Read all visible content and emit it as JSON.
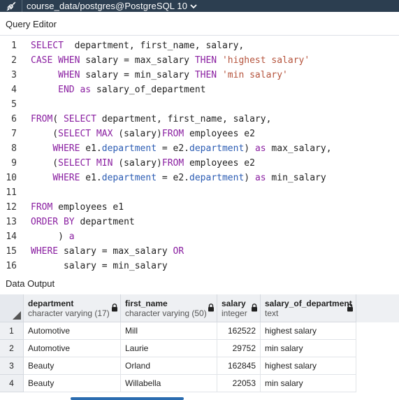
{
  "connection": {
    "label": "course_data/postgres@PostgreSQL 10"
  },
  "query_editor": {
    "title": "Query Editor",
    "lines": [
      {
        "n": "1",
        "segments": [
          [
            "kw",
            "SELECT"
          ],
          [
            "",
            "  department, first_name, salary,"
          ]
        ]
      },
      {
        "n": "2",
        "segments": [
          [
            "kw",
            "CASE WHEN"
          ],
          [
            "",
            " salary = max_salary "
          ],
          [
            "kw",
            "THEN"
          ],
          [
            "",
            " "
          ],
          [
            "st",
            "'highest salary'"
          ]
        ]
      },
      {
        "n": "3",
        "segments": [
          [
            "",
            "     "
          ],
          [
            "kw",
            "WHEN"
          ],
          [
            "",
            " salary = min_salary "
          ],
          [
            "kw",
            "THEN"
          ],
          [
            "",
            " "
          ],
          [
            "st",
            "'min salary'"
          ]
        ]
      },
      {
        "n": "4",
        "segments": [
          [
            "",
            "     "
          ],
          [
            "kw",
            "END"
          ],
          [
            "",
            " "
          ],
          [
            "kw",
            "as"
          ],
          [
            "",
            " salary_of_department"
          ]
        ]
      },
      {
        "n": "5",
        "segments": []
      },
      {
        "n": "6",
        "segments": [
          [
            "kw",
            "FROM"
          ],
          [
            "",
            "( "
          ],
          [
            "kw",
            "SELECT"
          ],
          [
            "",
            " department, first_name, salary,"
          ]
        ]
      },
      {
        "n": "7",
        "segments": [
          [
            "",
            "    ("
          ],
          [
            "kw",
            "SELECT MAX"
          ],
          [
            "",
            " (salary)"
          ],
          [
            "kw",
            "FROM"
          ],
          [
            "",
            " employees e2"
          ]
        ]
      },
      {
        "n": "8",
        "segments": [
          [
            "",
            "    "
          ],
          [
            "kw",
            "WHERE"
          ],
          [
            "",
            " e1."
          ],
          [
            "fld",
            "department"
          ],
          [
            "",
            " = e2."
          ],
          [
            "fld",
            "department"
          ],
          [
            "",
            ") "
          ],
          [
            "kw",
            "as"
          ],
          [
            "",
            " max_salary,"
          ]
        ]
      },
      {
        "n": "9",
        "segments": [
          [
            "",
            "    ("
          ],
          [
            "kw",
            "SELECT MIN"
          ],
          [
            "",
            " (salary)"
          ],
          [
            "kw",
            "FROM"
          ],
          [
            "",
            " employees e2"
          ]
        ]
      },
      {
        "n": "10",
        "segments": [
          [
            "",
            "    "
          ],
          [
            "kw",
            "WHERE"
          ],
          [
            "",
            " e1."
          ],
          [
            "fld",
            "department"
          ],
          [
            "",
            " = e2."
          ],
          [
            "fld",
            "department"
          ],
          [
            "",
            ") "
          ],
          [
            "kw",
            "as"
          ],
          [
            "",
            " min_salary"
          ]
        ]
      },
      {
        "n": "11",
        "segments": []
      },
      {
        "n": "12",
        "segments": [
          [
            "kw",
            "FROM"
          ],
          [
            "",
            " employees e1"
          ]
        ]
      },
      {
        "n": "13",
        "segments": [
          [
            "kw",
            "ORDER BY"
          ],
          [
            "",
            " department"
          ]
        ]
      },
      {
        "n": "14",
        "segments": [
          [
            "",
            "     ) "
          ],
          [
            "kw",
            "a"
          ]
        ]
      },
      {
        "n": "15",
        "segments": [
          [
            "kw",
            "WHERE"
          ],
          [
            "",
            " salary = max_salary "
          ],
          [
            "kw",
            "OR"
          ]
        ]
      },
      {
        "n": "16",
        "segments": [
          [
            "",
            "      salary = min_salary"
          ]
        ]
      }
    ]
  },
  "data_output": {
    "title": "Data Output",
    "columns": [
      {
        "name": "department",
        "type": "character varying (17)",
        "locked": true
      },
      {
        "name": "first_name",
        "type": "character varying (50)",
        "locked": true
      },
      {
        "name": "salary",
        "type": "integer",
        "locked": true
      },
      {
        "name": "salary_of_department",
        "type": "text",
        "locked": true
      }
    ],
    "rows": [
      {
        "n": "1",
        "cells": [
          "Automotive",
          "Mill",
          "162522",
          "highest salary"
        ]
      },
      {
        "n": "2",
        "cells": [
          "Automotive",
          "Laurie",
          "29752",
          "min salary"
        ]
      },
      {
        "n": "3",
        "cells": [
          "Beauty",
          "Orland",
          "162845",
          "highest salary"
        ]
      },
      {
        "n": "4",
        "cells": [
          "Beauty",
          "Willabella",
          "22053",
          "min salary"
        ]
      }
    ]
  },
  "colors": {
    "connection_bar": "#2c3e50",
    "keyword": "#8a1fa1",
    "string": "#b5533c",
    "field": "#2a5bb3",
    "scrollbar": "#2b6cb0"
  }
}
